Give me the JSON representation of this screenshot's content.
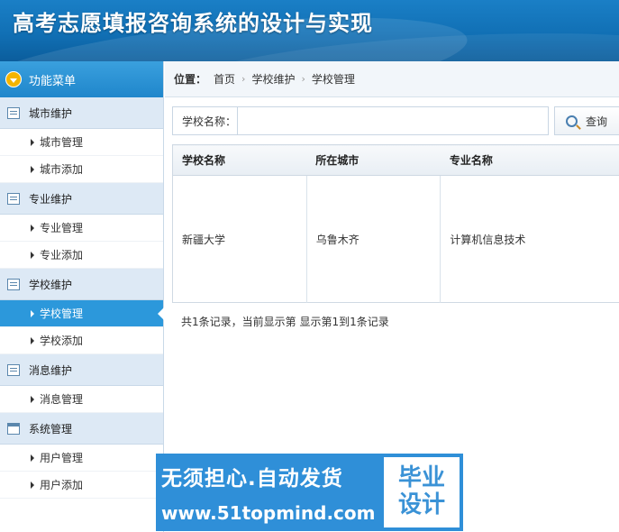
{
  "header": {
    "title": "高考志愿填报咨询系统的设计与实现"
  },
  "sidebar": {
    "menu_title": "功能菜单",
    "groups": [
      {
        "label": "城市维护",
        "items": [
          {
            "label": "城市管理"
          },
          {
            "label": "城市添加"
          }
        ]
      },
      {
        "label": "专业维护",
        "items": [
          {
            "label": "专业管理"
          },
          {
            "label": "专业添加"
          }
        ]
      },
      {
        "label": "学校维护",
        "items": [
          {
            "label": "学校管理"
          },
          {
            "label": "学校添加"
          }
        ]
      },
      {
        "label": "消息维护",
        "items": [
          {
            "label": "消息管理"
          }
        ]
      },
      {
        "label": "系统管理",
        "items": [
          {
            "label": "用户管理"
          },
          {
            "label": "用户添加"
          }
        ]
      }
    ],
    "active_item": "学校管理"
  },
  "breadcrumb": {
    "label": "位置：",
    "items": [
      "首页",
      "学校维护",
      "学校管理"
    ]
  },
  "search": {
    "label": "学校名称：",
    "value": "",
    "placeholder": "",
    "button_label": "查询"
  },
  "table": {
    "columns": [
      "学校名称",
      "所在城市",
      "专业名称"
    ],
    "rows": [
      [
        "新疆大学",
        "乌鲁木齐",
        "计算机信息技术"
      ]
    ]
  },
  "pager": {
    "text": "共1条记录，当前显示第  显示第1到1条记录"
  },
  "watermark": {
    "line1": "无须担心.自动发货",
    "line2": "www.51topmind.com",
    "right_top": "毕业",
    "right_bottom": "设计"
  },
  "colors": {
    "header": "#1170b5",
    "active": "#2c98db",
    "group_bg": "#dde9f5"
  }
}
